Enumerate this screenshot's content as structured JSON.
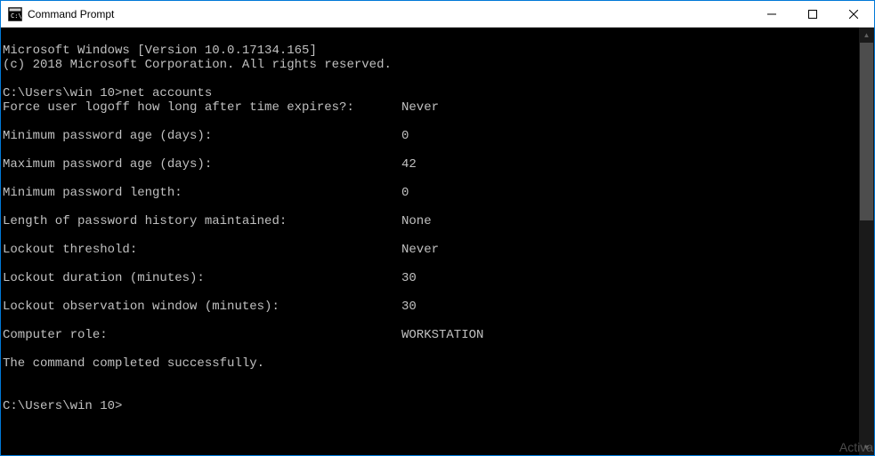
{
  "window": {
    "title": "Command Prompt"
  },
  "terminal": {
    "banner_line1": "Microsoft Windows [Version 10.0.17134.165]",
    "banner_line2": "(c) 2018 Microsoft Corporation. All rights reserved.",
    "prompt1_path": "C:\\Users\\win 10>",
    "prompt1_command": "net accounts",
    "rows": [
      {
        "label": "Force user logoff how long after time expires?:",
        "value": "Never"
      },
      {
        "label": "Minimum password age (days):",
        "value": "0"
      },
      {
        "label": "Maximum password age (days):",
        "value": "42"
      },
      {
        "label": "Minimum password length:",
        "value": "0"
      },
      {
        "label": "Length of password history maintained:",
        "value": "None"
      },
      {
        "label": "Lockout threshold:",
        "value": "Never"
      },
      {
        "label": "Lockout duration (minutes):",
        "value": "30"
      },
      {
        "label": "Lockout observation window (minutes):",
        "value": "30"
      },
      {
        "label": "Computer role:",
        "value": "WORKSTATION"
      }
    ],
    "completion_msg": "The command completed successfully.",
    "prompt2_path": "C:\\Users\\win 10>"
  },
  "watermark": "Activa"
}
